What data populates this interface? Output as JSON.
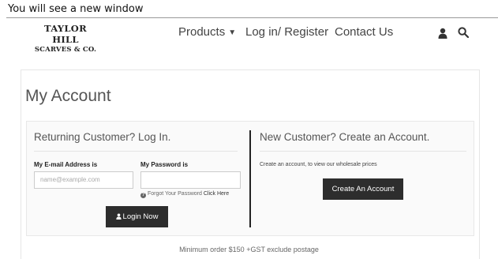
{
  "caption": "You will see a new window",
  "header": {
    "logo_line1": "TAYLOR HILL",
    "logo_line2": "SCARVES & CO.",
    "nav": {
      "products": "Products",
      "login_register": "Log in/ Register",
      "contact": "Contact Us"
    },
    "icons": [
      "user-icon",
      "search-icon"
    ]
  },
  "page": {
    "title": "My Account"
  },
  "login": {
    "heading": "Returning Customer? Log In.",
    "email_label": "My E-mail Address is",
    "email_placeholder": "name@example.com",
    "password_label": "My Password is",
    "forgot_text": "Forgot Your Password",
    "forgot_link": "Click Here",
    "button_label": "Login Now"
  },
  "register": {
    "heading": "New Customer? Create an Account.",
    "description": "Create an account, to view our wholesale prices",
    "button_label": "Create An Account"
  },
  "footer_note": "Minimum order $150 +GST exclude postage",
  "colors": {
    "button_bg": "#2d2d2d",
    "text": "#555555",
    "divider": "#222222"
  }
}
